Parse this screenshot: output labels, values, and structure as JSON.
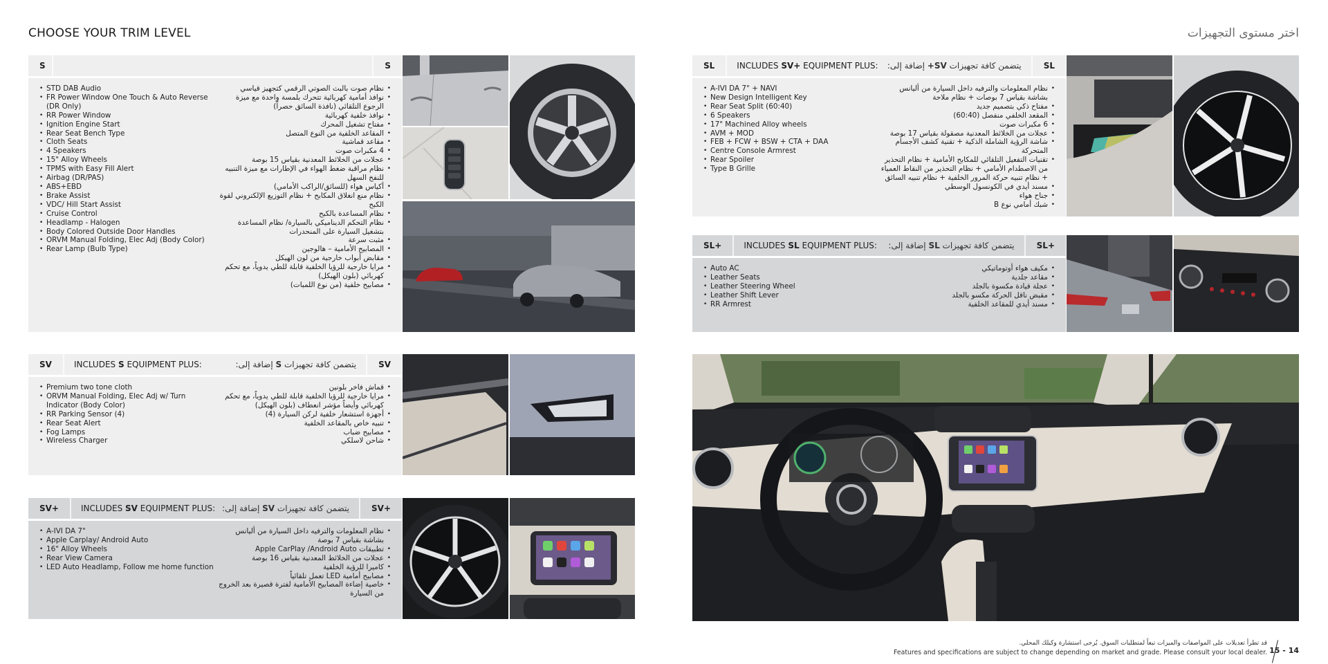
{
  "header": {
    "title_en": "CHOOSE YOUR TRIM LEVEL",
    "title_ar": "اختر مستوى التجهيزات"
  },
  "trims": {
    "s": {
      "tag": "S",
      "includes_en_prefix": "",
      "includes_en_base": "",
      "includes_en_suffix": "",
      "includes_ar": "",
      "features_en": [
        "STD DAB Audio",
        "FR Power Window One Touch & Auto Reverse (DR Only)",
        "RR Power Window",
        "Ignition Engine Start",
        "Rear Seat Bench Type",
        "Cloth Seats",
        "4 Speakers",
        "15\" Alloy Wheels",
        "TPMS with Easy Fill Alert",
        "Airbag (DR/PAS)",
        "ABS+EBD",
        "Brake Assist",
        "VDC/ Hill Start Assist",
        "Cruise Control",
        "Headlamp - Halogen",
        "Body Colored Outside Door Handles",
        "ORVM Manual Folding, Elec Adj (Body Color)",
        "Rear Lamp (Bulb Type)"
      ],
      "features_ar": [
        "نظام صوت بالبث الصوتي الرقمي كتجهيز قياسي",
        "نوافذ أمامية كهربائية تتحرك بلمسة واحدة مع ميزة الرجوع التلقائي (نافذة السائق حصراً)",
        "نوافذ خلفية كهربائية",
        "مفتاح تشغيل المحرك",
        "المقاعد الخلفية من النوع المتصل",
        "مقاعد قماشية",
        "4 مكبرات صوت",
        "عجلات من الخلائط المعدنية بقياس 15 بوصة",
        "نظام مراقبة ضغط الهواء في الإطارات مع ميزة التنبيه للنفخ السهل",
        "أكياس هواء (للسائق/الراكب الأمامي)",
        "نظام منع انغلاق المكابح + نظام التوزيع الإلكتروني لقوة الكبح",
        "نظام المساعدة بالكبح",
        "نظام التحكم الديناميكي بالسيارة/ نظام المساعدة بتشغيل السيارة على المنحدرات",
        "مثبت سرعة",
        "المصابيح الأمامية – هالوجين",
        "مقابض أبواب خارجية من لون الهيكل",
        "مرايا خارجية للرؤيا الخلفية قابلة للطي يدوياً، مع تحكم كهربائي (بلون الهيكل)",
        "مصابيح خلفية (من نوع اللمبات)"
      ]
    },
    "sv": {
      "tag": "SV",
      "includes_en_prefix": "INCLUDES ",
      "includes_en_base": "S",
      "includes_en_suffix": " EQUIPMENT PLUS:",
      "includes_ar_prefix": "يتضمن كافة تجهيزات ",
      "includes_ar_base": "S",
      "includes_ar_suffix": " إضافة إلى:",
      "features_en": [
        "Premium two tone cloth",
        "ORVM Manual Folding, Elec Adj w/ Turn Indicator (Body Color)",
        "RR Parking Sensor (4)",
        "Rear Seat Alert",
        "Fog Lamps",
        "Wireless Charger"
      ],
      "features_ar": [
        "قماش فاخر بلونين",
        "مرايا خارجية للرؤيا الخلفية قابلة للطي يدوياً، مع تحكم كهربائي وأيضاً مؤشر انعطاف (بلون الهيكل)",
        "أجهزة استشعار خلفية لركن السيارة (4)",
        "تنبيه خاص بالمقاعد الخلفية",
        "مصابيح ضباب",
        "شاحن لاسلكي"
      ]
    },
    "sv_plus": {
      "tag": "SV+",
      "includes_en_prefix": "INCLUDES ",
      "includes_en_base": "SV",
      "includes_en_suffix": " EQUIPMENT PLUS:",
      "includes_ar_prefix": "يتضمن كافة تجهيزات ",
      "includes_ar_base": "SV",
      "includes_ar_suffix": " إضافة إلى:",
      "features_en": [
        "A-IVI DA 7\"",
        "Apple Carplay/ Android Auto",
        "16\" Alloy Wheels",
        "Rear View Camera",
        "LED Auto Headlamp, Follow me home function"
      ],
      "features_ar": [
        "نظام المعلومات والترفيه داخل السيارة من أليانس بشاشة بقياس 7 بوصة",
        "تطبيقات Apple CarPlay /Android Auto",
        "عجلات من الخلائط المعدنية بقياس 16 بوصة",
        "كاميرا للرؤية الخلفية",
        "مصابيح أمامية LED تعمل تلقائياً",
        "خاصية إضاءة المصابيح الأمامية لفترة قصيرة بعد الخروج من السيارة"
      ]
    },
    "sl": {
      "tag": "SL",
      "includes_en_prefix": "INCLUDES ",
      "includes_en_base": "SV+",
      "includes_en_suffix": " EQUIPMENT PLUS:",
      "includes_ar_prefix": "يتضمن كافة تجهيزات ",
      "includes_ar_base": "SV+",
      "includes_ar_suffix": " إضافة إلى:",
      "features_en": [
        "A-IVI DA 7\" + NAVI",
        "New Design Intelligent Key",
        "Rear Seat Split (60:40)",
        "6 Speakers",
        "17\" Machined Alloy wheels",
        "AVM + MOD",
        "FEB + FCW + BSW + CTA + DAA",
        "Centre Console Armrest",
        "Rear Spoiler",
        "Type B Grille"
      ],
      "features_ar": [
        "نظام المعلومات والترفيه داخل السيارة من أليانس بشاشة بقياس 7 بوصات + نظام ملاحة",
        "مفتاح ذكي بتصميم جديد",
        "المقعد الخلفي منفصل (60:40)",
        "6 مكبرات صوت",
        "عجلات من الخلائط المعدنية مصقولة بقياس 17 بوصة",
        "شاشة الرؤية الشاملة الذكية + تقنية كشف الأجسام المتحركة",
        "تقنيات التفعيل التلقائي للمكابح الأمامية + نظام التحذير من الاصطدام الأمامي + نظام التحذير من النقاط العمياء + نظام تنبيه حركة المرور الخلفية + نظام تنبيه السائق",
        "مسند أيدي في الكونسول الوسطي",
        "جناح هواء",
        "شبك أمامي نوع B"
      ]
    },
    "sl_plus": {
      "tag": "SL+",
      "includes_en_prefix": "INCLUDES ",
      "includes_en_base": "SL",
      "includes_en_suffix": " EQUIPMENT PLUS:",
      "includes_ar_prefix": "يتضمن كافة تجهيزات ",
      "includes_ar_base": "SL",
      "includes_ar_suffix": " إضافة إلى:",
      "features_en": [
        "Auto AC",
        "Leather Seats",
        "Leather Steering Wheel",
        "Leather Shift Lever",
        "RR Armrest"
      ],
      "features_ar": [
        "مكيف هواء أوتوماتيكي",
        "مقاعد جلدية",
        "عجلة قيادة مكسوة بالجلد",
        "مقبض ناقل الحركة مكسو بالجلد",
        "مسند أيدي للمقاعد الخلفية"
      ]
    }
  },
  "footer": {
    "disclaimer_ar": "قد تطرأ تعديلات على المواصفات والميزات تبعاً لمتطلبات السوق. يُرجى استشارة وكيلك المحلي.",
    "disclaimer_en": "Features and specifications are subject to change depending on market and grade. Please consult your local dealer.",
    "page_numbers": "15 - 14"
  },
  "colors": {
    "panel_light": "#efefef",
    "panel_dark": "#d5d6d8",
    "title_ar": "#6b6b6b"
  }
}
